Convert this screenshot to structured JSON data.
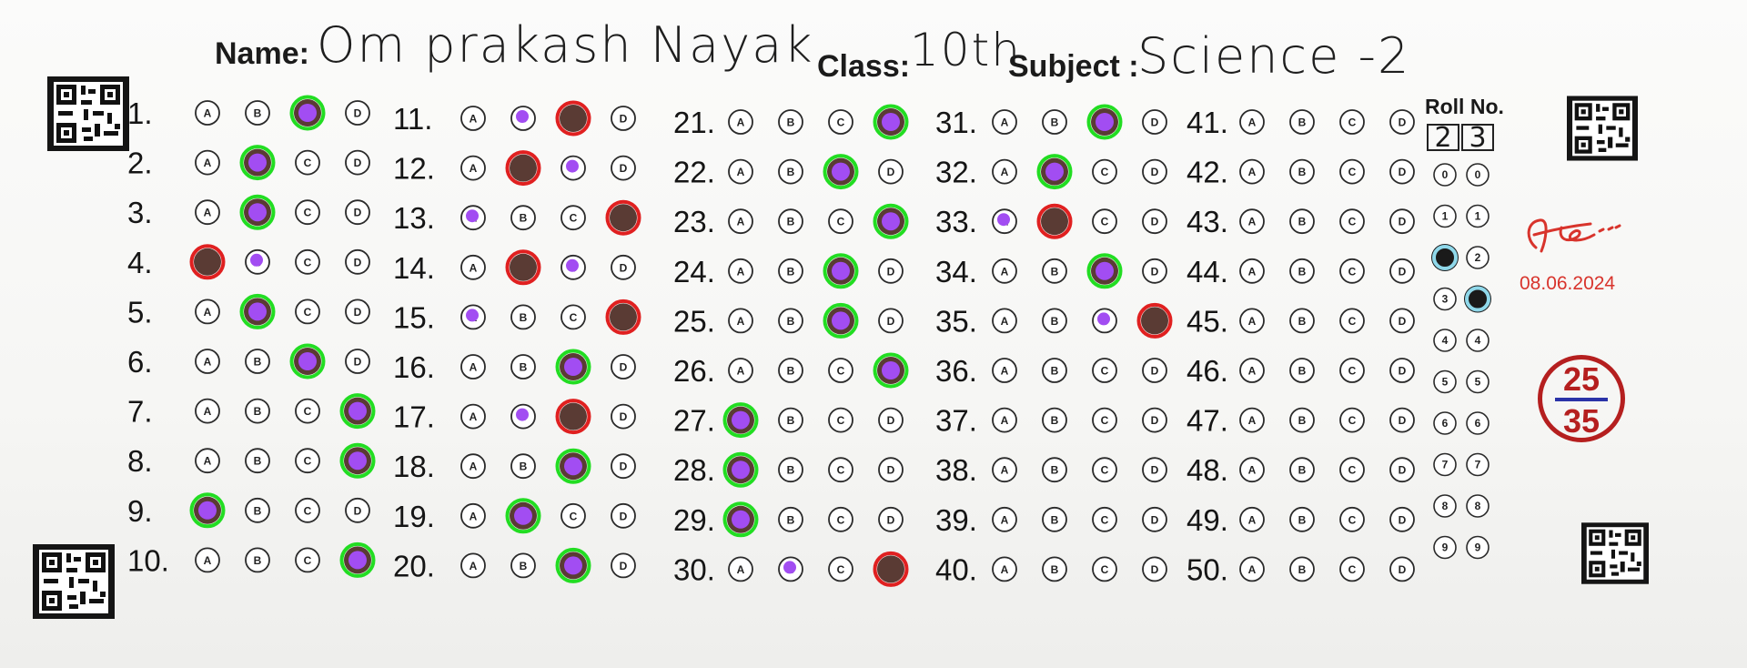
{
  "header": {
    "name_label": "Name:",
    "name_value": "Om prakash Nayak",
    "class_label": "Class:",
    "class_value": "10th",
    "subject_label": "Subject :",
    "subject_value": "Science -2"
  },
  "options": [
    "A",
    "B",
    "C",
    "D"
  ],
  "question_numbers": [
    "1.",
    "2.",
    "3.",
    "4.",
    "5.",
    "6.",
    "7.",
    "8.",
    "9.",
    "10.",
    "11.",
    "12.",
    "13.",
    "14.",
    "15.",
    "16.",
    "17.",
    "18.",
    "19.",
    "20.",
    "21.",
    "22.",
    "23.",
    "24.",
    "25.",
    "26.",
    "27.",
    "28.",
    "29.",
    "30.",
    "31.",
    "32.",
    "33.",
    "34.",
    "35.",
    "36.",
    "37.",
    "38.",
    "39.",
    "40.",
    "41.",
    "42.",
    "43.",
    "44.",
    "45.",
    "46.",
    "47.",
    "48.",
    "49.",
    "50."
  ],
  "answers": [
    {
      "q": 1,
      "marked": "C",
      "correct": "C",
      "result": "correct"
    },
    {
      "q": 2,
      "marked": "B",
      "correct": "B",
      "result": "correct"
    },
    {
      "q": 3,
      "marked": "B",
      "correct": "B",
      "result": "correct"
    },
    {
      "q": 4,
      "marked": "A",
      "correct": "B",
      "result": "wrong"
    },
    {
      "q": 5,
      "marked": "B",
      "correct": "B",
      "result": "correct"
    },
    {
      "q": 6,
      "marked": "C",
      "correct": "C",
      "result": "correct"
    },
    {
      "q": 7,
      "marked": "D",
      "correct": "D",
      "result": "correct"
    },
    {
      "q": 8,
      "marked": "D",
      "correct": "D",
      "result": "correct"
    },
    {
      "q": 9,
      "marked": "A",
      "correct": "A",
      "result": "correct"
    },
    {
      "q": 10,
      "marked": "D",
      "correct": "D",
      "result": "correct"
    },
    {
      "q": 11,
      "marked": "C",
      "correct": "B",
      "result": "wrong"
    },
    {
      "q": 12,
      "marked": "B",
      "correct": "C",
      "result": "wrong"
    },
    {
      "q": 13,
      "marked": "D",
      "correct": "A",
      "result": "wrong"
    },
    {
      "q": 14,
      "marked": "B",
      "correct": "C",
      "result": "wrong"
    },
    {
      "q": 15,
      "marked": "D",
      "correct": "A",
      "result": "wrong"
    },
    {
      "q": 16,
      "marked": "C",
      "correct": "C",
      "result": "correct"
    },
    {
      "q": 17,
      "marked": "C",
      "correct": "B",
      "result": "wrong"
    },
    {
      "q": 18,
      "marked": "C",
      "correct": "C",
      "result": "correct"
    },
    {
      "q": 19,
      "marked": "B",
      "correct": "B",
      "result": "correct"
    },
    {
      "q": 20,
      "marked": "C",
      "correct": "C",
      "result": "correct"
    },
    {
      "q": 21,
      "marked": "D",
      "correct": "D",
      "result": "correct"
    },
    {
      "q": 22,
      "marked": "C",
      "correct": "C",
      "result": "correct"
    },
    {
      "q": 23,
      "marked": "D",
      "correct": "D",
      "result": "correct"
    },
    {
      "q": 24,
      "marked": "C",
      "correct": "C",
      "result": "correct"
    },
    {
      "q": 25,
      "marked": "C",
      "correct": "C",
      "result": "correct"
    },
    {
      "q": 26,
      "marked": "D",
      "correct": "D",
      "result": "correct"
    },
    {
      "q": 27,
      "marked": "A",
      "correct": "A",
      "result": "correct"
    },
    {
      "q": 28,
      "marked": "A",
      "correct": "A",
      "result": "correct"
    },
    {
      "q": 29,
      "marked": "A",
      "correct": "A",
      "result": "correct"
    },
    {
      "q": 30,
      "marked": "D",
      "correct": "B",
      "result": "wrong"
    },
    {
      "q": 31,
      "marked": "C",
      "correct": "C",
      "result": "correct"
    },
    {
      "q": 32,
      "marked": "B",
      "correct": "B",
      "result": "correct"
    },
    {
      "q": 33,
      "marked": "B",
      "correct": "A",
      "result": "wrong"
    },
    {
      "q": 34,
      "marked": "C",
      "correct": "C",
      "result": "correct"
    },
    {
      "q": 35,
      "marked": "D",
      "correct": "C",
      "result": "wrong"
    }
  ],
  "roll": {
    "title": "Roll No.",
    "digits": [
      "2",
      "3"
    ],
    "scale": [
      "0",
      "1",
      "2",
      "3",
      "4",
      "5",
      "6",
      "7",
      "8",
      "9"
    ]
  },
  "date": "08.06.2024",
  "score": {
    "obtained": "25",
    "total": "35"
  },
  "colors": {
    "correct_ring": "#22dd22",
    "wrong_ring": "#e02020",
    "answer_key_dot": "#a24df2",
    "student_mark": "#5a3b34",
    "roll_ring": "#8fd8ea",
    "score": "#b51f1f",
    "date": "#d8342c"
  },
  "icons": [
    "qr-code-icon",
    "signature-mark"
  ]
}
